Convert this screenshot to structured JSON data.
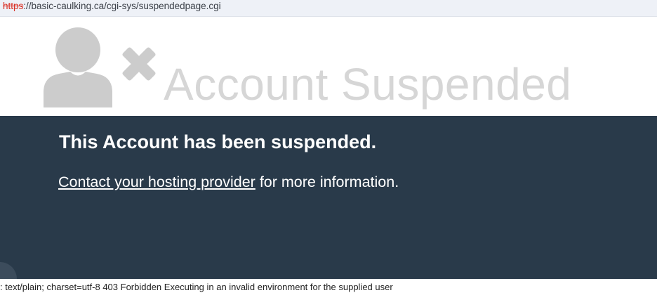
{
  "address_bar": {
    "scheme": "https",
    "rest": "://basic-caulking.ca/cgi-sys/suspendedpage.cgi"
  },
  "hero": {
    "title": "Account Suspended",
    "icon": "user-remove-icon",
    "icon_color": "#cccccc"
  },
  "panel": {
    "heading": "This Account has been suspended.",
    "contact_link": "Contact your hosting provider",
    "contact_suffix": " for more information.",
    "background": "#293a4a"
  },
  "footer": {
    "text": ": text/plain; charset=utf-8 403 Forbidden Executing in an invalid environment for the supplied user"
  }
}
